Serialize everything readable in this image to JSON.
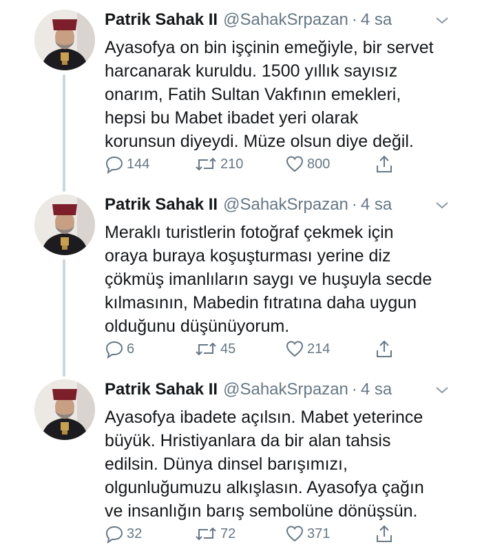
{
  "colors": {
    "text": "#14171a",
    "secondary": "#657786",
    "thread_line": "#ccd6dd"
  },
  "tweets": [
    {
      "name": "Patrik Sahak II",
      "handle": "@SahakSrpazan",
      "separator": "·",
      "time": "4 sa",
      "lines": [
        "Ayasofya on bin işçinin emeğiyle, bir servet",
        "harcanarak kuruldu. 1500 yıllık sayısız",
        "onarım, Fatih Sultan Vakfının emekleri,",
        "hepsi bu Mabet ibadet yeri olarak",
        "korunsun diyeydi. Müze olsun diye değil."
      ],
      "replies": "144",
      "retweets": "210",
      "likes": "800"
    },
    {
      "name": "Patrik Sahak II",
      "handle": "@SahakSrpazan",
      "separator": "·",
      "time": "4 sa",
      "lines": [
        "Meraklı turistlerin fotoğraf çekmek için",
        "oraya buraya koşuşturması yerine diz",
        "çökmüş imanlıların saygı ve huşuyla secde",
        "kılmasının, Mabedin fıtratına daha uygun",
        "olduğunu düşünüyorum."
      ],
      "replies": "6",
      "retweets": "45",
      "likes": "214"
    },
    {
      "name": "Patrik Sahak II",
      "handle": "@SahakSrpazan",
      "separator": "·",
      "time": "4 sa",
      "lines": [
        "Ayasofya ibadete açılsın. Mabet yeterince",
        "büyük. Hristiyanlara da bir alan tahsis",
        "edilsin. Dünya dinsel barışımızı,",
        "olgunluğumuzu alkışlasın. Ayasofya çağın",
        "ve insanlığın barış sembolüne dönüşsün."
      ],
      "replies": "32",
      "retweets": "72",
      "likes": "371"
    }
  ]
}
